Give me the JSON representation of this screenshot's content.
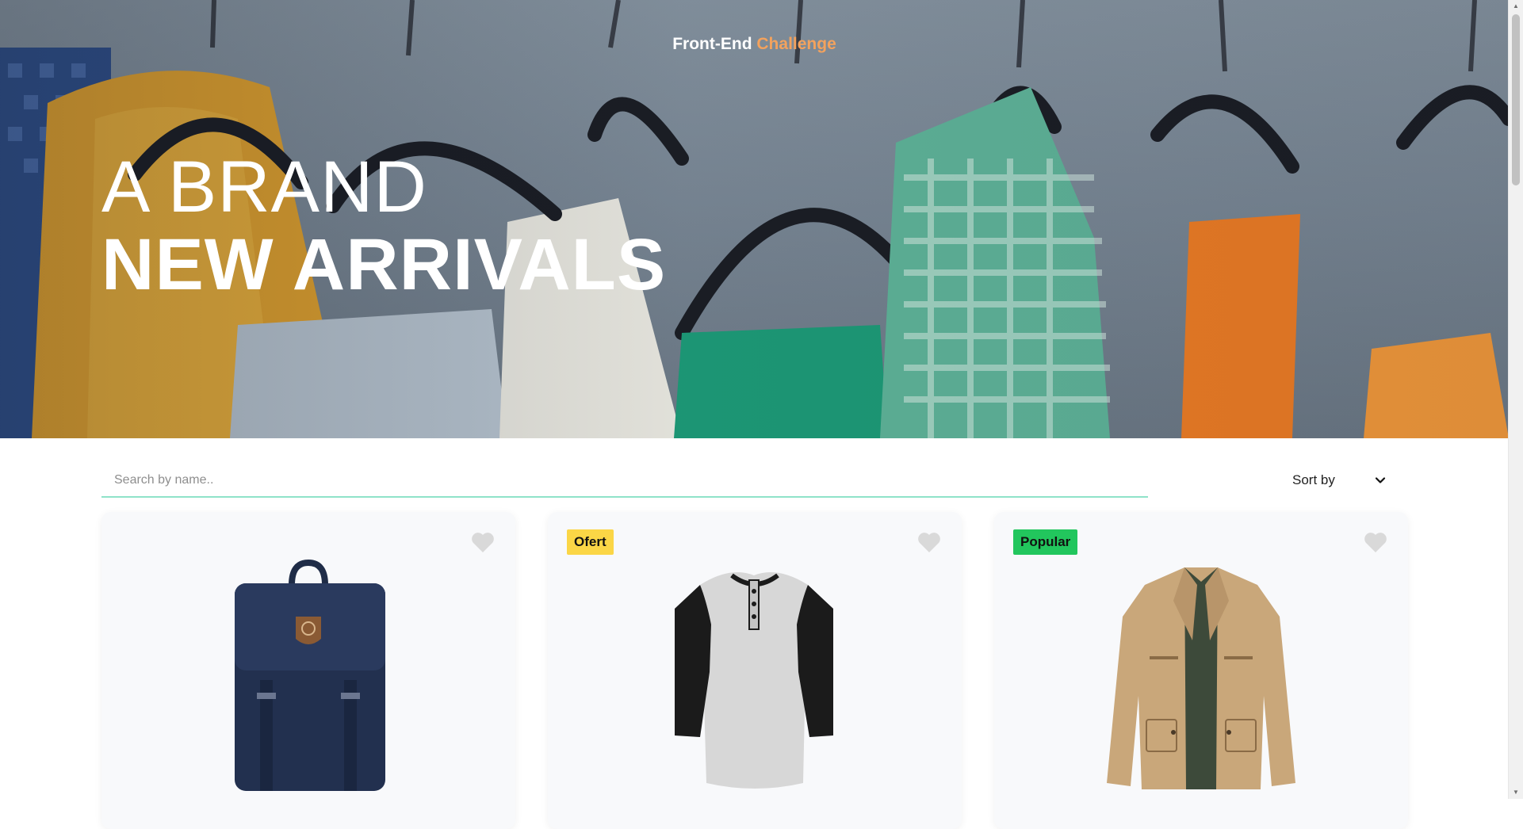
{
  "header": {
    "brand_part1": "Front-End",
    "brand_part2": "Challenge",
    "headline_line1": "A BRAND",
    "headline_line2": "NEW ARRIVALS"
  },
  "filters": {
    "search_placeholder": "Search by name..",
    "sort_label": "Sort by"
  },
  "products": [
    {
      "badge": "",
      "image": "navy-backpack",
      "favorite_icon": "heart-icon"
    },
    {
      "badge": "Ofert",
      "image": "raglan-henley-shirt",
      "favorite_icon": "heart-icon"
    },
    {
      "badge": "Popular",
      "image": "khaki-jacket",
      "favorite_icon": "heart-icon"
    }
  ],
  "colors": {
    "brand_accent": "#f3a25d",
    "search_underline": "#8fe3c9",
    "ofert_badge": "#fbd646",
    "popular_badge": "#22c65d",
    "card_background": "#f8f9fb"
  }
}
